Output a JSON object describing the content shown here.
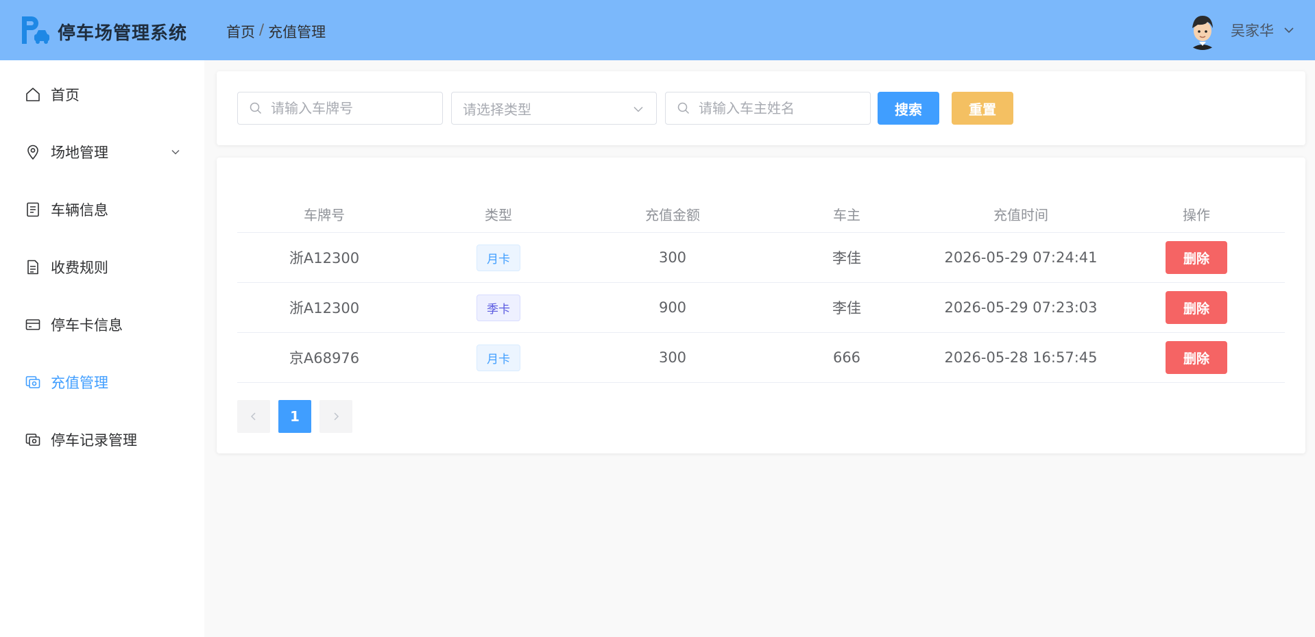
{
  "header": {
    "app_title": "停车场管理系统",
    "breadcrumb": [
      "首页",
      "充值管理"
    ],
    "breadcrumb_sep": "/",
    "user_name": "吴家华"
  },
  "colors": {
    "header_bg": "#7bb8fb",
    "accent": "#409eff",
    "reset": "#f4c062",
    "danger": "#f56464"
  },
  "sidebar": {
    "items": [
      {
        "label": "首页",
        "icon": "home-icon",
        "active": false
      },
      {
        "label": "场地管理",
        "icon": "location-icon",
        "active": false,
        "expandable": true
      },
      {
        "label": "车辆信息",
        "icon": "document-icon",
        "active": false
      },
      {
        "label": "收费规则",
        "icon": "file-icon",
        "active": false
      },
      {
        "label": "停车卡信息",
        "icon": "credit-card-icon",
        "active": false
      },
      {
        "label": "充值管理",
        "icon": "wallet-icon",
        "active": true
      },
      {
        "label": "停车记录管理",
        "icon": "record-icon",
        "active": false
      }
    ]
  },
  "search": {
    "plate_placeholder": "请输入车牌号",
    "type_placeholder": "请选择类型",
    "owner_placeholder": "请输入车主姓名",
    "search_label": "搜索",
    "reset_label": "重置"
  },
  "table": {
    "columns": [
      "车牌号",
      "类型",
      "充值金额",
      "车主",
      "充值时间",
      "操作"
    ],
    "rows": [
      {
        "plate": "浙A12300",
        "type": "月卡",
        "amount": "300",
        "owner": "李佳",
        "time": "2026-05-29 07:24:41",
        "action": "删除"
      },
      {
        "plate": "浙A12300",
        "type": "季卡",
        "amount": "900",
        "owner": "李佳",
        "time": "2026-05-29 07:23:03",
        "action": "删除"
      },
      {
        "plate": "京A68976",
        "type": "月卡",
        "amount": "300",
        "owner": "666",
        "time": "2026-05-28 16:57:45",
        "action": "删除"
      }
    ]
  },
  "pagination": {
    "current_page": "1"
  }
}
